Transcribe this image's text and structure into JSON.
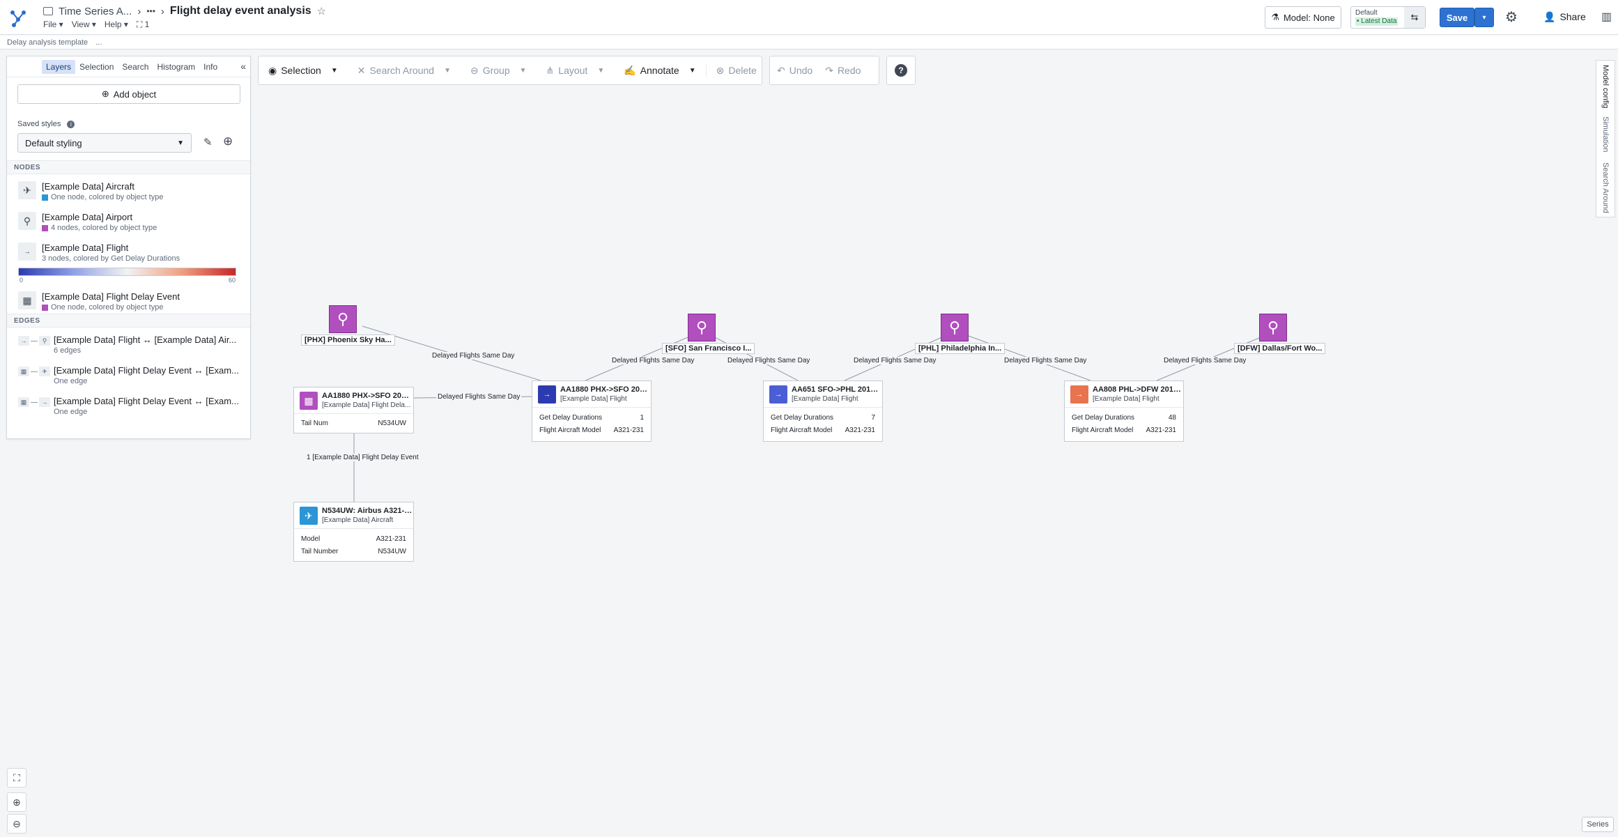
{
  "header": {
    "breadcrumb_parent": "Time Series A...",
    "more": "•••",
    "title": "Flight delay event analysis",
    "menus": [
      "File",
      "View",
      "Help"
    ],
    "graph_count": "1",
    "model_label": "Model: None",
    "scenario_top": "Default",
    "scenario_bottom": "• Latest Data",
    "save_label": "Save",
    "share_label": "Share"
  },
  "subheader": {
    "template": "Delay analysis template",
    "ellipsis": "..."
  },
  "panel": {
    "tabs": [
      "Layers",
      "Selection",
      "Search",
      "Histogram",
      "Info"
    ],
    "add_object": "Add object",
    "saved_styles_label": "Saved styles",
    "saved_style_value": "Default styling",
    "nodes_header": "NODES",
    "nodes": [
      {
        "title": "[Example Data] Aircraft",
        "desc": "One node, colored by object type",
        "color": "#2b95d6"
      },
      {
        "title": "[Example Data] Airport",
        "desc": "4 nodes, colored by object type",
        "color": "#b14fbf"
      },
      {
        "title": "[Example Data] Flight",
        "desc": "3 nodes, colored by Get Delay Durations"
      },
      {
        "title": "[Example Data] Flight Delay Event",
        "desc": "One node, colored by object type",
        "color": "#b14fbf"
      }
    ],
    "gradient_min": "0",
    "gradient_max": "60",
    "edges_header": "EDGES",
    "edges": [
      {
        "title": "[Example Data] Flight ↔ [Example Data] Air...",
        "desc": "6 edges"
      },
      {
        "title": "[Example Data] Flight Delay Event ↔ [Exam...",
        "desc": "One edge"
      },
      {
        "title": "[Example Data] Flight Delay Event ↔ [Exam...",
        "desc": "One edge"
      }
    ]
  },
  "toolbar": {
    "selection": "Selection",
    "search_around": "Search Around",
    "group": "Group",
    "layout": "Layout",
    "annotate": "Annotate",
    "delete": "Delete",
    "undo": "Undo",
    "redo": "Redo",
    "help": "?"
  },
  "graph": {
    "airports": [
      {
        "label": "[PHX] Phoenix Sky Ha..."
      },
      {
        "label": "[SFO] San Francisco I..."
      },
      {
        "label": "[PHL] Philadelphia In..."
      },
      {
        "label": "[DFW] Dallas/Fort Wo..."
      }
    ],
    "edge_label": "Delayed Flights Same Day",
    "event_edge_label": "1 [Example Data] Flight Delay Event",
    "event_node": {
      "title": "AA1880 PHX->SFO 2018-...",
      "type": "[Example Data] Flight Dela...",
      "prop_k": "Tail Num",
      "prop_v": "N534UW"
    },
    "flights": [
      {
        "title": "AA1880 PHX->SFO 2018-...",
        "type": "[Example Data] Flight",
        "k1": "Get Delay Durations",
        "v1": "1",
        "k2": "Flight Aircraft Model",
        "v2": "A321-231",
        "color": "#2d3bb0"
      },
      {
        "title": "AA651 SFO->PHL 2018-0...",
        "type": "[Example Data] Flight",
        "k1": "Get Delay Durations",
        "v1": "7",
        "k2": "Flight Aircraft Model",
        "v2": "A321-231",
        "color": "#4a5fd6"
      },
      {
        "title": "AA808 PHL->DFW 2018-...",
        "type": "[Example Data] Flight",
        "k1": "Get Delay Durations",
        "v1": "48",
        "k2": "Flight Aircraft Model",
        "v2": "A321-231",
        "color": "#e8734f"
      }
    ],
    "aircraft": {
      "title": "N534UW: Airbus A321-231",
      "type": "[Example Data] Aircraft",
      "k1": "Model",
      "v1": "A321-231",
      "k2": "Tail Number",
      "v2": "N534UW"
    }
  },
  "right_rail": [
    "Model config",
    "Simulation",
    "Search Around"
  ],
  "footer": {
    "series": "Series"
  }
}
